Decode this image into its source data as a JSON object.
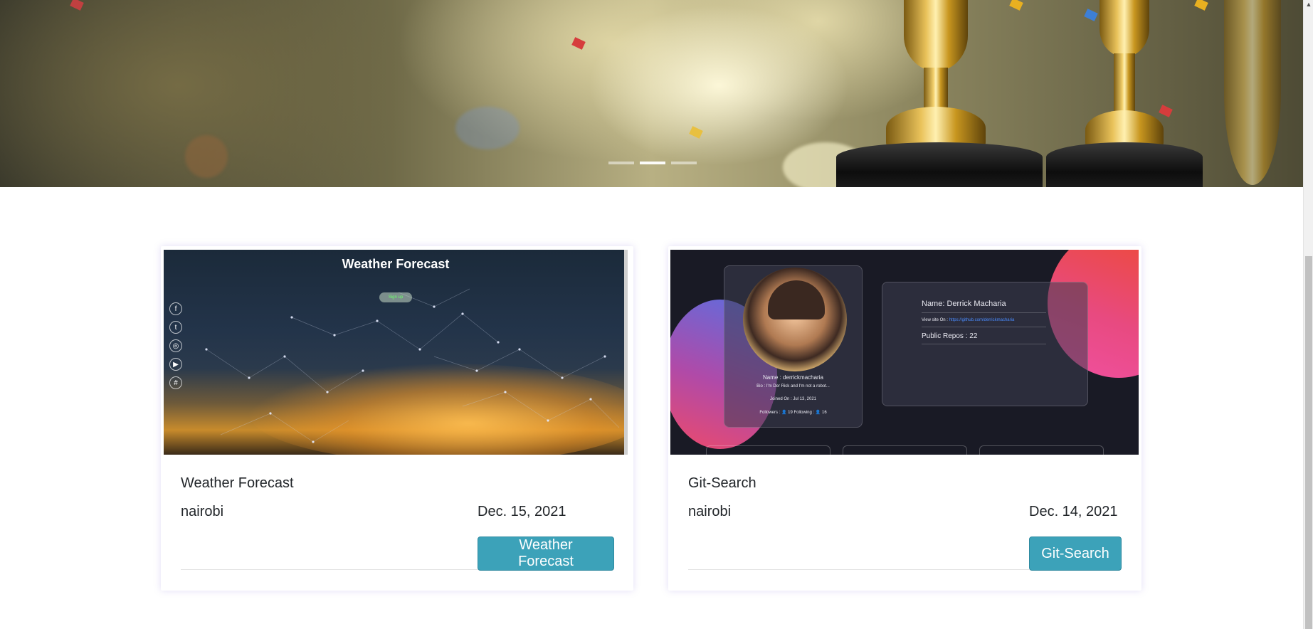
{
  "hero": {
    "indicators": [
      {
        "label": "Slide 1",
        "active": false
      },
      {
        "label": "Slide 2",
        "active": true
      },
      {
        "label": "Slide 3",
        "active": false
      }
    ]
  },
  "projects": [
    {
      "title": "Weather Forecast",
      "location": "nairobi",
      "date": "Dec. 15, 2021",
      "button_label": "Weather Forecast",
      "screenshot": {
        "heading": "Weather Forecast",
        "pill_label": "Sign up",
        "social_icons": [
          "facebook-icon",
          "twitter-icon",
          "instagram-icon",
          "youtube-icon",
          "slack-icon"
        ]
      }
    },
    {
      "title": "Git-Search",
      "location": "nairobi",
      "date": "Dec. 14, 2021",
      "button_label": "Git-Search",
      "screenshot": {
        "profile_name": "Name : derrickmacharia",
        "profile_bio": "Bio : I'm Der Rick and I'm not a robot...",
        "joined": "Joined On : Jul 13, 2021",
        "followers": "Followers : 👤 19    Following : 👤 16",
        "info_name": "Name: Derrick Macharia",
        "view_site_label": "View site On :",
        "view_site_link": "https://github.com/derrickmacharia",
        "public_repos": "Public Repos : 22"
      }
    }
  ],
  "colors": {
    "button_bg": "#3ca2b9",
    "card_shadow": "#8c78dc"
  }
}
